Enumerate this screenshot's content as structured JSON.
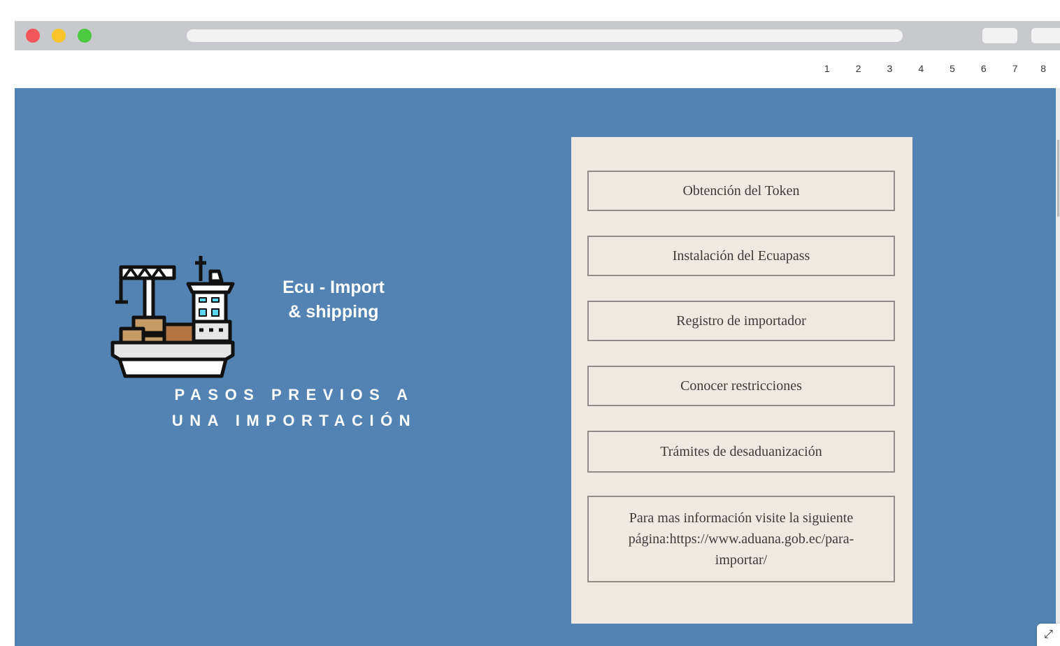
{
  "window": {
    "controls": [
      "close",
      "minimize",
      "maximize"
    ]
  },
  "pagination": [
    "1",
    "2",
    "3",
    "4",
    "5",
    "6",
    "7",
    "8"
  ],
  "hero": {
    "brand_line1": "Ecu - Import",
    "brand_line2": "& shipping",
    "tagline_line1": "PASOS PREVIOS A",
    "tagline_line2": "UNA IMPORTACIÓN",
    "background_color": "#5283b2",
    "logo_icon": "cargo-ship-with-crane-icon"
  },
  "menu": {
    "items": [
      "Obtención del Token",
      "Instalación del Ecuapass",
      "Registro de importador",
      "Conocer restricciones",
      "Trámites de desaduanización",
      "Para mas información visite la siguiente página:https://www.aduana.gob.ec/para-importar/"
    ],
    "panel_color": "#efe9e2"
  },
  "expand_icon": "expand-icon"
}
